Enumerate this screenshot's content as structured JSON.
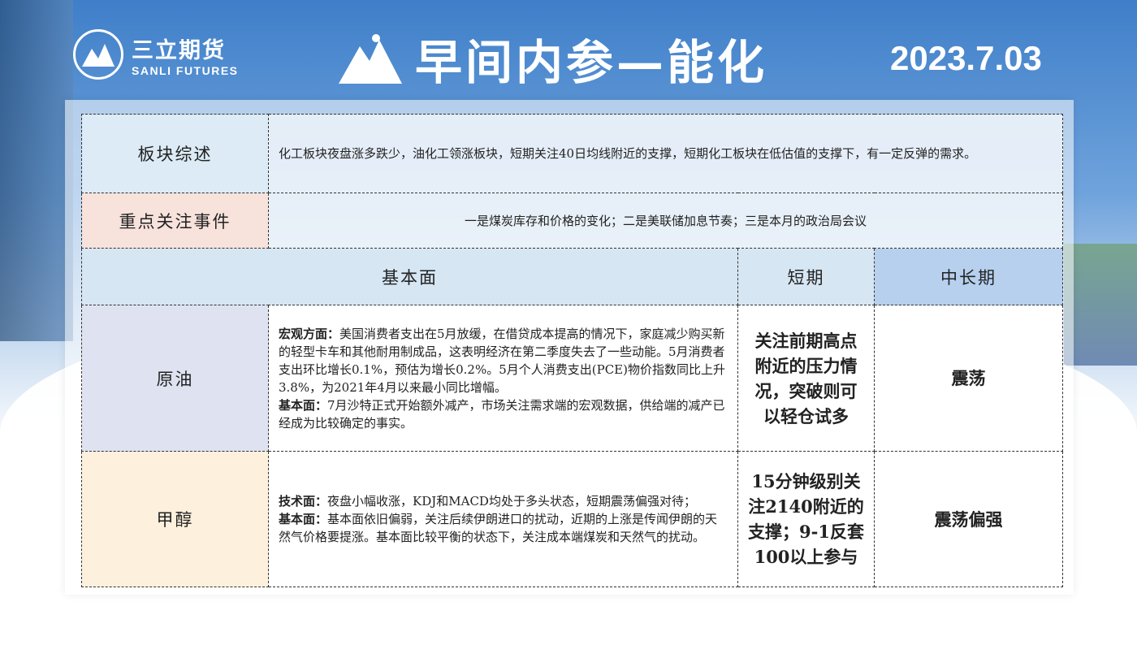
{
  "header": {
    "logo_cn": "三立期货",
    "logo_en": "SANLI FUTURES",
    "title": "早间内参—能化",
    "date": "2023.7.03"
  },
  "table": {
    "sector_label": "板块综述",
    "sector_text": "化工板块夜盘涨多跌少，油化工领涨板块，短期关注40日均线附近的支撑，短期化工板块在低估值的支撑下，有一定反弹的需求。",
    "events_label": "重点关注事件",
    "events_text": "一是煤炭库存和价格的变化；二是美联储加息节奏；三是本月的政治局会议",
    "headers": {
      "fundamentals": "基本面",
      "short": "短期",
      "long": "中长期"
    },
    "rows": [
      {
        "name": "原油",
        "p1_label": "宏观方面：",
        "p1": "美国消费者支出在5月放缓，在借贷成本提高的情况下，家庭减少购买新的轻型卡车和其他耐用制成品，这表明经济在第二季度失去了一些动能。5月消费者支出环比增长0.1%，预估为增长0.2%。5月个人消费支出(PCE)物价指数同比上升3.8%，为2021年4月以来最小同比增幅。",
        "p2_label": "基本面：",
        "p2": "7月沙特正式开始额外减产，市场关注需求端的宏观数据，供给端的减产已经成为比较确定的事实。",
        "short": "关注前期高点附近的压力情况，突破则可以轻仓试多",
        "long": "震荡"
      },
      {
        "name": "甲醇",
        "p1_label": "技术面：",
        "p1": "夜盘小幅收涨，KDJ和MACD均处于多头状态，短期震荡偏强对待；",
        "p2_label": "基本面：",
        "p2": "基本面依旧偏弱，关注后续伊朗进口的扰动，近期的上涨是传闻伊朗的天然气价格要提涨。基本面比较平衡的状态下，关注成本端煤炭和天然气的扰动。",
        "short": "15分钟级别关注2140附近的支撑；9-1反套100以上参与",
        "long": "震荡偏强"
      }
    ]
  },
  "colors": {
    "sector_bg": "#dcebf5",
    "events_bg": "#f7e2dc",
    "header_bg": "#d6e6f3",
    "long_header_bg": "#b6d0ee",
    "crude_bg": "#dfe3f1",
    "methanol_bg": "#fdf0dc"
  }
}
